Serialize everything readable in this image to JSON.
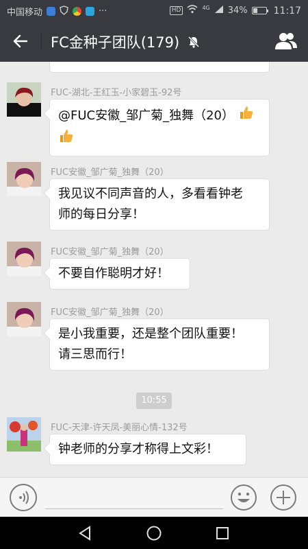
{
  "status_bar": {
    "carrier": "中国移动",
    "more": "···",
    "hd": "HD",
    "network": "4G",
    "battery_percent": "34%",
    "battery_level": 0.34,
    "time": "11:17"
  },
  "header": {
    "title": "FC金种子团队(179)",
    "muted": true,
    "icons": [
      "back-arrow-icon",
      "mute-bell-icon",
      "group-members-icon"
    ]
  },
  "messages": [
    {
      "sender": "FUC-湖北-王红玉-小家碧玉-92号",
      "lines": [
        "@FUC安徽_邹广菊_独舞（20）"
      ],
      "emoji": [
        "thumbs-up",
        "thumbs-up"
      ]
    },
    {
      "sender": "FUC安徽_邹广菊_独舞（20）",
      "lines": [
        "我见议不同声音的人，多看看钟老",
        "师的每日分享！"
      ]
    },
    {
      "sender": "FUC安徽_邹广菊_独舞（20）",
      "lines": [
        "不要自作聪明才好！"
      ]
    },
    {
      "sender": "FUC安徽_邹广菊_独舞（20）",
      "lines": [
        "是小我重要，还是整个团队重要！",
        "请三思而行！"
      ]
    },
    {
      "sender": "FUC-天津-许天凤-美丽心情-132号",
      "lines": [
        "钟老师的分享才称得上文彩！"
      ]
    }
  ],
  "timestamp": "10:55",
  "input": {
    "value": "",
    "icons": [
      "voice-icon",
      "emoji-icon",
      "plus-icon"
    ]
  },
  "navigation": {
    "icons": [
      "back-triangle-icon",
      "home-circle-icon",
      "recents-square-icon"
    ]
  },
  "colors": {
    "header_bg": "#393a3f",
    "chat_bg": "#ebebeb",
    "bubble_bg": "#ffffff",
    "timestamp_bg": "#cecece",
    "thumbs_up": "#f5b13b"
  }
}
